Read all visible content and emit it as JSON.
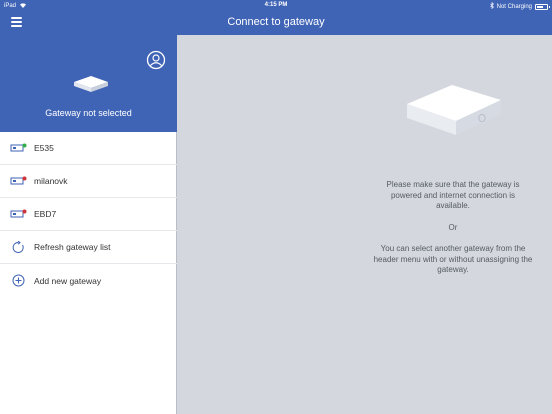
{
  "status_bar": {
    "device": "iPad",
    "time": "4:15 PM",
    "charging": "Not Charging",
    "battery_level": 0.7
  },
  "nav": {
    "title": "Connect to gateway",
    "menu_icon": "hamburger-icon"
  },
  "sidebar": {
    "gateway_status": "Gateway not selected",
    "user_icon": "user-circle-icon",
    "gateways": [
      {
        "label": "E535",
        "icon": "gateway-green-icon",
        "status_color": "#2fae4a"
      },
      {
        "label": "milanovk",
        "icon": "gateway-red-icon",
        "status_color": "#d0343a"
      },
      {
        "label": "EBD7",
        "icon": "gateway-red-icon",
        "status_color": "#d0343a"
      }
    ],
    "actions": [
      {
        "label": "Refresh gateway list",
        "icon": "refresh-icon"
      },
      {
        "label": "Add new gateway",
        "icon": "plus-circle-icon"
      }
    ]
  },
  "main": {
    "message_primary": "Please make sure that the gateway is powered and internet connection is available.",
    "message_or": "Or",
    "message_secondary": "You can select another gateway from the header menu with or without unassigning the gateway."
  },
  "colors": {
    "header_blue": "#3f63b5",
    "main_bg": "#d4d8de",
    "icon_blue": "#3f63b5"
  }
}
